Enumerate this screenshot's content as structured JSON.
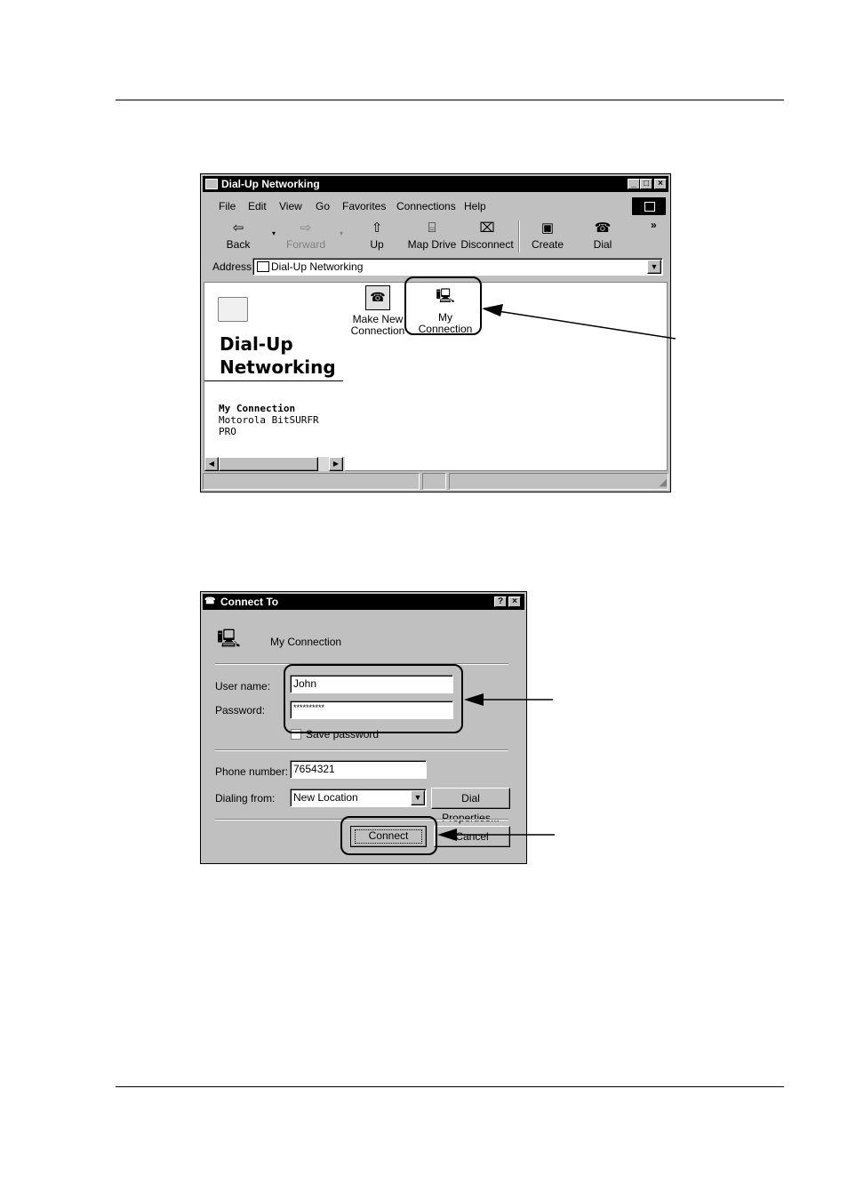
{
  "dialup": {
    "title": "Dial-Up Networking",
    "menu": [
      "File",
      "Edit",
      "View",
      "Go",
      "Favorites",
      "Connections",
      "Help"
    ],
    "toolbar": {
      "back": "Back",
      "forward": "Forward",
      "up": "Up",
      "map_drive": "Map Drive",
      "disconnect": "Disconnect",
      "create": "Create",
      "dial": "Dial",
      "more": "»"
    },
    "address_label": "Address",
    "address_value": "Dial-Up Networking",
    "left_panel": {
      "heading_line1": "Dial-Up",
      "heading_line2": "Networking",
      "selected_name": "My Connection",
      "selected_desc_line1": "Motorola BitSURFR",
      "selected_desc_line2": "PRO"
    },
    "icons": {
      "make_new_line1": "Make New",
      "make_new_line2": "Connection",
      "my_connection": "My Connection"
    }
  },
  "connect_dialog": {
    "title": "Connect To",
    "connection_name": "My Connection",
    "user_name_label": "User name:",
    "user_name_value": "John",
    "password_label": "Password:",
    "password_value": "**********",
    "save_password_label": "Save password",
    "phone_label": "Phone number:",
    "phone_value": "7654321",
    "dialing_from_label": "Dialing from:",
    "dialing_from_value": "New Location",
    "dial_properties_label": "Dial Properties...",
    "connect_label": "Connect",
    "cancel_label": "Cancel"
  }
}
